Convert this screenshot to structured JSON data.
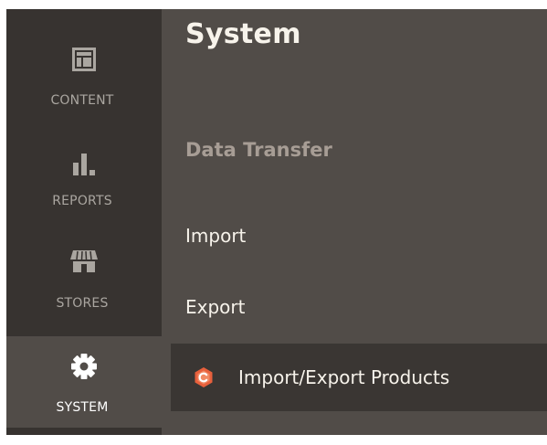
{
  "sidebar": {
    "items": [
      {
        "label": "CONTENT",
        "icon": "content-layout-icon"
      },
      {
        "label": "REPORTS",
        "icon": "bar-chart-icon"
      },
      {
        "label": "STORES",
        "icon": "storefront-icon"
      },
      {
        "label": "SYSTEM",
        "icon": "gear-icon",
        "active": true
      }
    ]
  },
  "panel": {
    "title": "System",
    "section": {
      "title": "Data Transfer",
      "links": [
        {
          "label": "Import"
        },
        {
          "label": "Export"
        },
        {
          "label": "Import/Export Products",
          "icon": "extension-logo-icon",
          "icon_color": "#e8603c"
        }
      ]
    }
  },
  "colors": {
    "sidebar_bg": "#373330",
    "panel_bg": "#514c48",
    "accent": "#e8603c"
  }
}
